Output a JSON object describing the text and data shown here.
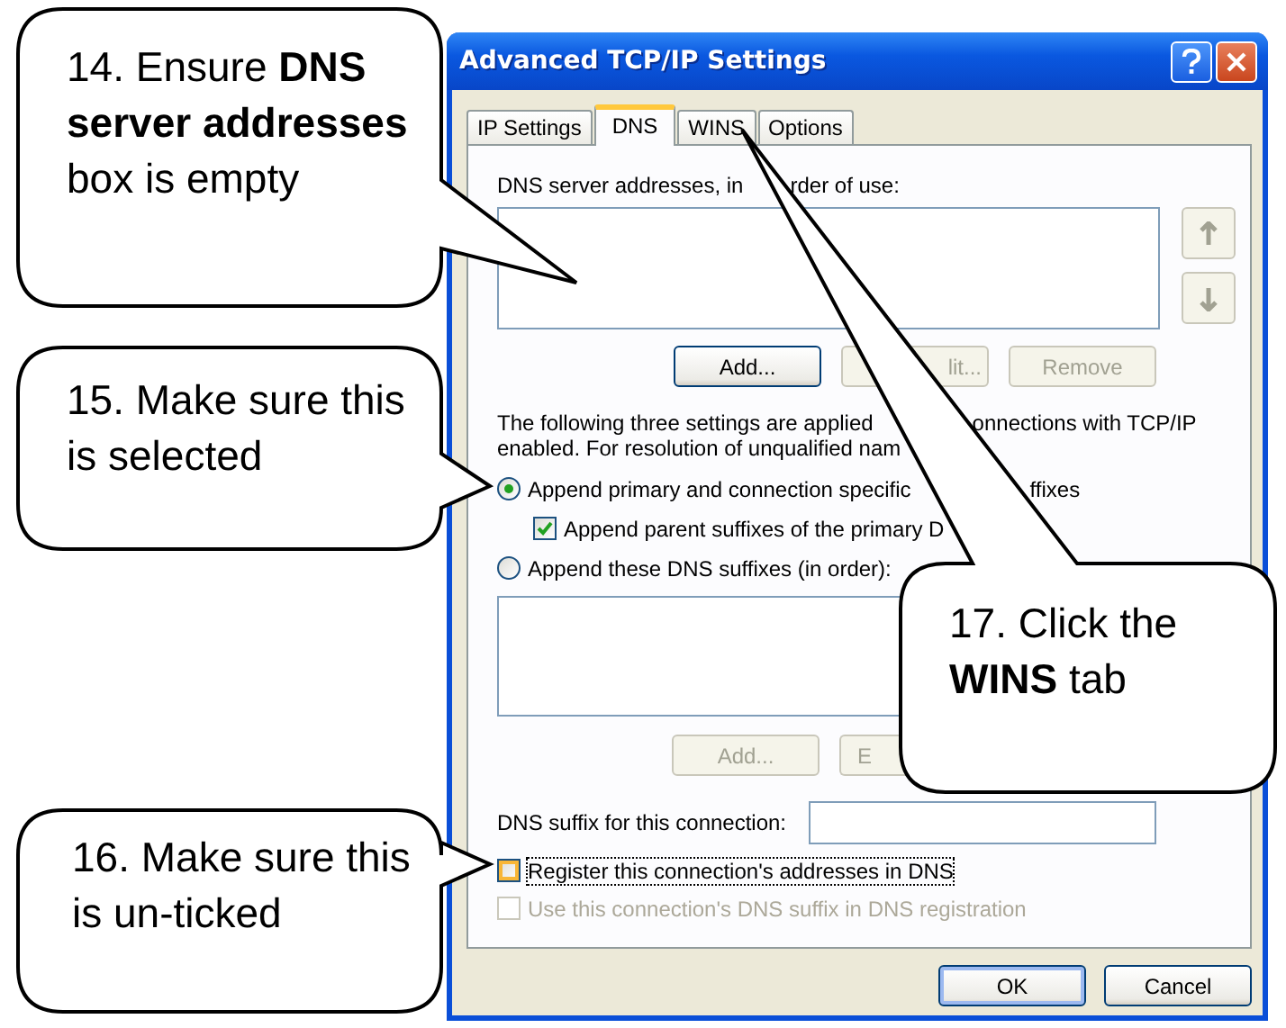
{
  "window": {
    "title": "Advanced TCP/IP Settings"
  },
  "tabs": [
    {
      "label": "IP Settings",
      "selected": false
    },
    {
      "label": "DNS",
      "selected": true
    },
    {
      "label": "WINS",
      "selected": false
    },
    {
      "label": "Options",
      "selected": false
    }
  ],
  "dns_servers": {
    "label_parts": [
      "DNS server addresses, in",
      "rder of use:"
    ],
    "buttons": [
      {
        "label": "Add...",
        "disabled": false
      },
      {
        "label": "lit...",
        "disabled": true
      },
      {
        "label": "Remove",
        "disabled": true
      }
    ]
  },
  "note_lines": [
    [
      "The following three settings are applied",
      "onnections with TCP/IP"
    ],
    [
      "enabled. For resolution of unqualified nam"
    ]
  ],
  "options": [
    {
      "kind": "radio",
      "parts": [
        "Append primary and connection specific",
        "ffixes"
      ],
      "selected": true
    },
    {
      "kind": "checkbox",
      "parts": [
        "Append parent suffixes of the primary D"
      ],
      "checked": true
    },
    {
      "kind": "radio",
      "parts": [
        "Append these DNS suffixes (in order):"
      ],
      "selected": false
    }
  ],
  "suffix_list": {
    "buttons": [
      {
        "label": "Add...",
        "disabled": true
      },
      {
        "label": "E",
        "disabled": true
      }
    ]
  },
  "suffix_field": {
    "label": "DNS suffix for this connection:"
  },
  "registration": [
    {
      "label": "Register this connection's addresses in DNS",
      "checked": false,
      "disabled": false,
      "focused": true
    },
    {
      "label": "Use this connection's DNS suffix in DNS registration",
      "checked": false,
      "disabled": true,
      "focused": false
    }
  ],
  "buttons": [
    {
      "label": "OK",
      "default": true
    },
    {
      "label": "Cancel",
      "default": false
    }
  ],
  "callouts": [
    {
      "text": "14. Ensure **DNS server addresses** box is empty"
    },
    {
      "text": "15. Make sure this is selected"
    },
    {
      "text": "16. Make sure this is un-ticked"
    },
    {
      "text": "17. Click the **WINS** tab"
    }
  ]
}
